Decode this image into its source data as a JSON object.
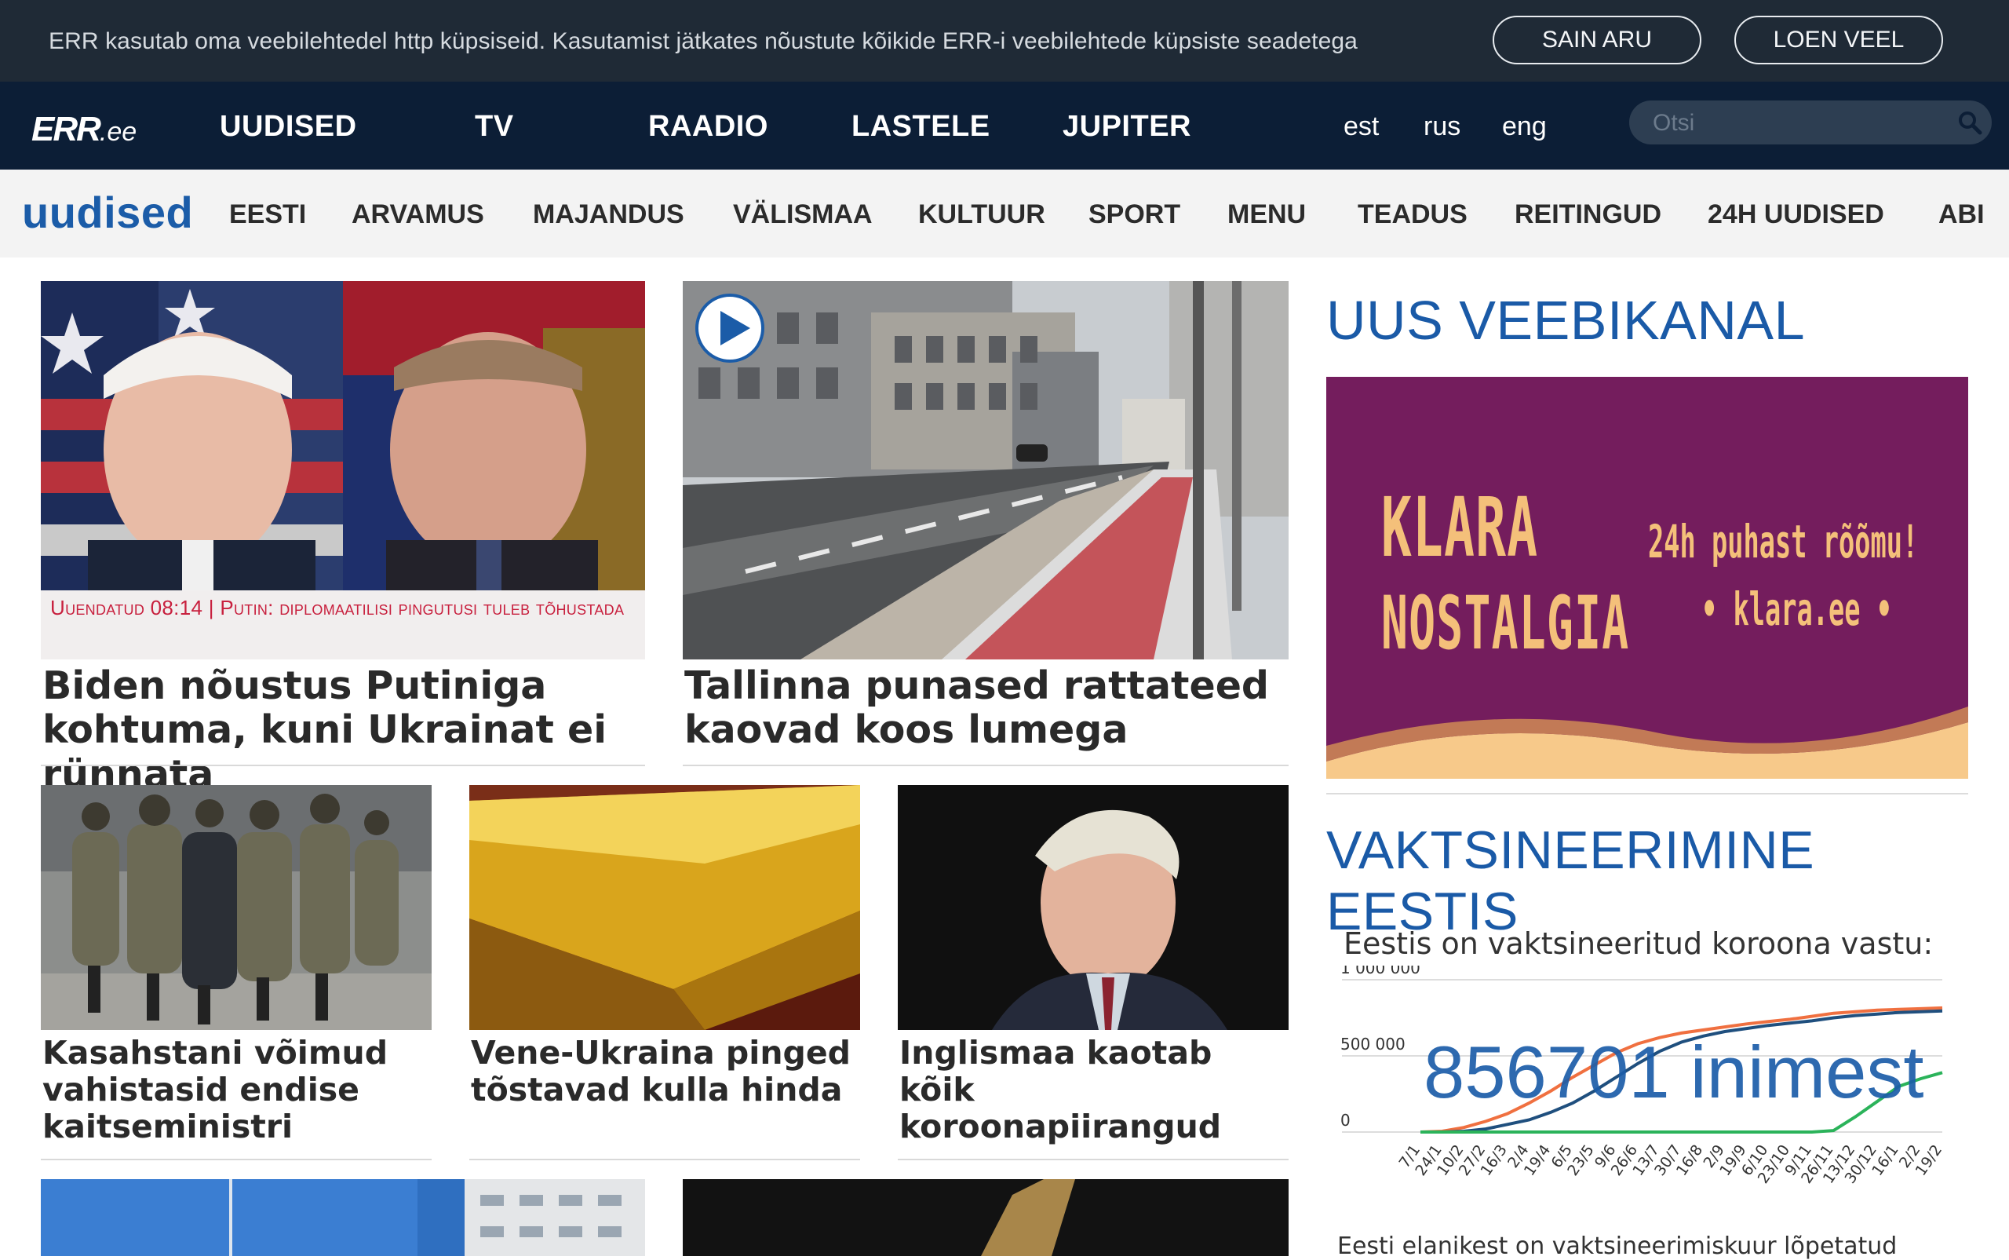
{
  "cookie": {
    "text": "ERR kasutab oma veebilehtedel http küpsiseid. Kasutamist jätkates nõustute kõikide ERR-i veebilehtede küpsiste seadetega",
    "accept_label": "SAIN ARU",
    "more_label": "LOEN VEEL"
  },
  "header": {
    "logo_err": "ERR",
    "logo_ee": ".ee",
    "nav": [
      "UUDISED",
      "TV",
      "RAADIO",
      "LASTELE",
      "JUPITER"
    ],
    "languages": [
      "est",
      "rus",
      "eng"
    ],
    "search_placeholder": "Otsi"
  },
  "section_nav": {
    "title": "uudised",
    "items": [
      "EESTI",
      "ARVAMUS",
      "MAJANDUS",
      "VÄLISMAA",
      "KULTUUR",
      "SPORT",
      "MENU",
      "TEADUS",
      "REITINGUD",
      "24H UUDISED",
      "ABI"
    ]
  },
  "articles": {
    "biden": {
      "banner": "Uuendatud 08:14 | Putin: diplomaatilisi pingutusi tuleb tõhustada",
      "headline": "Biden nõustus Putiniga kohtuma, kuni Ukrainat ei rünnata"
    },
    "tallinn": {
      "headline": "Tallinna punased rattateed kaovad koos lumega"
    },
    "kazakhstan": {
      "headline": "Kasahstani võimud vahistasid endise kaitseministri"
    },
    "gold": {
      "headline": "Vene-Ukraina pinged tõstavad kulla hinda"
    },
    "johnson": {
      "headline": "Inglismaa kaotab kõik koroonapiirangud"
    }
  },
  "sidebar": {
    "channel_heading": "UUS VEEBIKANAL",
    "klara": {
      "title_line1": "KLARA",
      "title_line2": "NOSTALGIA",
      "slogan": "24h puhast rõõmu!",
      "url": "• klara.ee •"
    },
    "vax_heading": "VAKTSINEERIMINE EESTIS",
    "vax_subtitle": "Eestis on vaktsineeritud koroona vastu:",
    "vax_count": "856701 inimest",
    "vax_footer": "Eesti elanikest on vaktsineerimiskuur lõpetatud"
  },
  "colors": {
    "accent_blue": "#1b5ca8",
    "nav_dark": "#0c1e36",
    "cookie_dark": "#1f2a36",
    "alert_red": "#c8203e",
    "klara_purple": "#741d5d",
    "klara_gold": "#f4c07a",
    "series_orange": "#f07040",
    "series_navy": "#1f4f7e",
    "series_green": "#2bb35a"
  },
  "chart_data": {
    "type": "line",
    "y_tick_labels": [
      "1 000 000",
      "500 000",
      "0"
    ],
    "ylim": [
      0,
      1000000
    ],
    "categories": [
      "7/1",
      "24/1",
      "10/2",
      "27/2",
      "16/3",
      "2/4",
      "19/4",
      "6/5",
      "23/5",
      "9/6",
      "26/6",
      "13/7",
      "30/7",
      "16/8",
      "2/9",
      "19/9",
      "6/10",
      "23/10",
      "9/11",
      "26/11",
      "13/12",
      "30/12",
      "16/1",
      "2/2",
      "19/2"
    ],
    "series": [
      {
        "values": [
          0,
          5000,
          30000,
          70000,
          120000,
          190000,
          270000,
          360000,
          440000,
          520000,
          580000,
          620000,
          650000,
          670000,
          690000,
          710000,
          725000,
          740000,
          760000,
          780000,
          790000,
          800000,
          805000,
          810000,
          815000
        ]
      },
      {
        "values": [
          0,
          0,
          5000,
          20000,
          50000,
          80000,
          130000,
          190000,
          270000,
          360000,
          450000,
          530000,
          590000,
          630000,
          660000,
          680000,
          700000,
          715000,
          730000,
          750000,
          765000,
          775000,
          785000,
          790000,
          795000
        ]
      },
      {
        "values": [
          0,
          0,
          0,
          0,
          0,
          0,
          0,
          0,
          0,
          0,
          0,
          0,
          0,
          0,
          0,
          0,
          0,
          0,
          0,
          10000,
          100000,
          200000,
          300000,
          350000,
          390000
        ]
      }
    ]
  }
}
